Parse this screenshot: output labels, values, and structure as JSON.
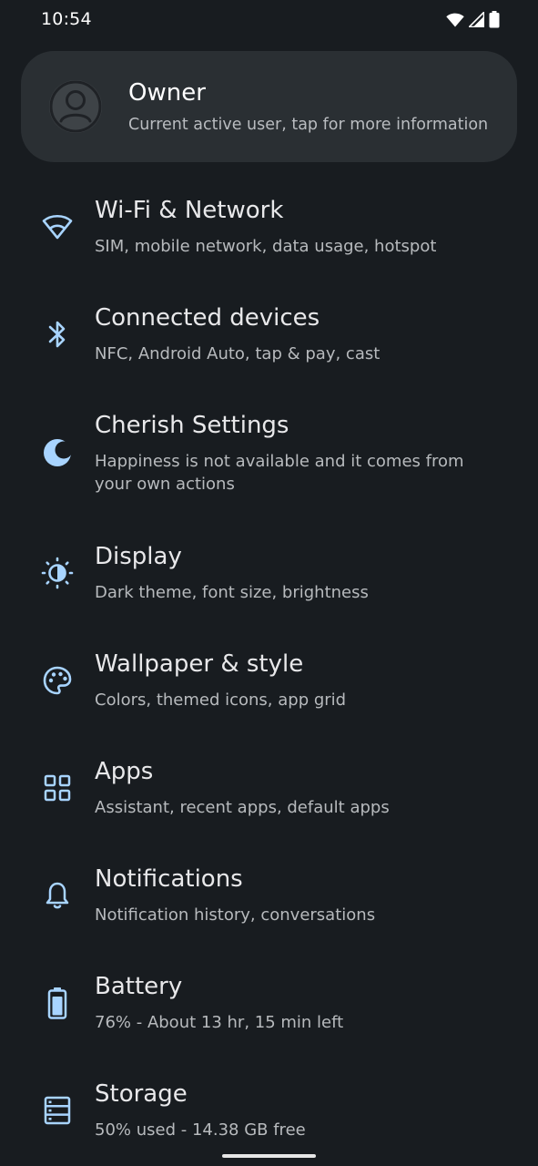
{
  "status_bar": {
    "time": "10:54",
    "icons": [
      "wifi-icon",
      "cell-signal-icon",
      "battery-icon"
    ]
  },
  "user_card": {
    "title": "Owner",
    "subtitle": "Current active user, tap for more information",
    "icon": "account-circle-icon"
  },
  "settings": {
    "items": [
      {
        "icon": "wifi-icon",
        "title": "Wi-Fi & Network",
        "subtitle": "SIM, mobile network, data usage, hotspot"
      },
      {
        "icon": "bluetooth-icon",
        "title": "Connected devices",
        "subtitle": "NFC, Android Auto, tap & pay, cast"
      },
      {
        "icon": "moon-icon",
        "title": "Cherish Settings",
        "subtitle": "Happiness is not available and it comes from your own actions"
      },
      {
        "icon": "brightness-icon",
        "title": "Display",
        "subtitle": "Dark theme, font size, brightness"
      },
      {
        "icon": "palette-icon",
        "title": "Wallpaper & style",
        "subtitle": "Colors, themed icons, app grid"
      },
      {
        "icon": "apps-grid-icon",
        "title": "Apps",
        "subtitle": "Assistant, recent apps, default apps"
      },
      {
        "icon": "bell-icon",
        "title": "Notifications",
        "subtitle": "Notification history, conversations"
      },
      {
        "icon": "battery-icon",
        "title": "Battery",
        "subtitle": "76% - About 13 hr, 15 min left"
      },
      {
        "icon": "storage-icon",
        "title": "Storage",
        "subtitle": "50% used - 14.38 GB free"
      }
    ]
  },
  "colors": {
    "background": "#181c20",
    "card": "#2a2f33",
    "accent_icon": "#a8d4ff"
  }
}
